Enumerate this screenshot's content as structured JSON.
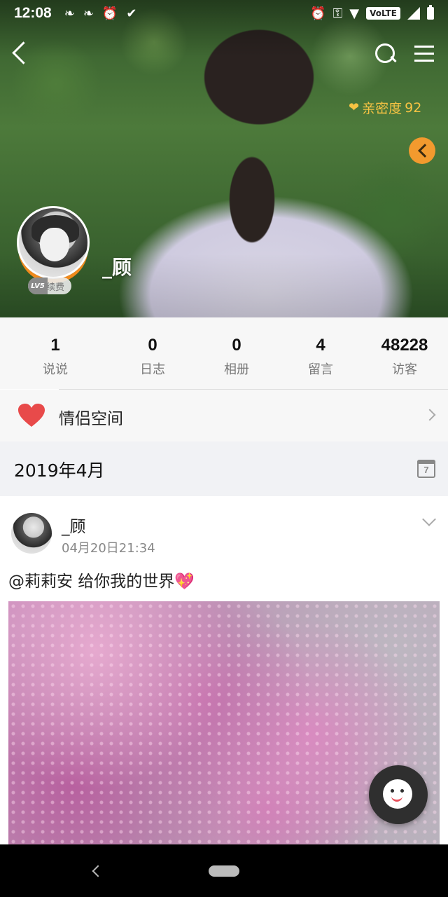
{
  "status_bar": {
    "time": "12:08",
    "volte": "VoLTE"
  },
  "profile": {
    "intimacy_label": "亲密度",
    "intimacy_value": "92",
    "username": "_顾",
    "vip_level": "LV5",
    "vip_action": "续费"
  },
  "stats": [
    {
      "value": "1",
      "label": "说说"
    },
    {
      "value": "0",
      "label": "日志"
    },
    {
      "value": "0",
      "label": "相册"
    },
    {
      "value": "4",
      "label": "留言"
    },
    {
      "value": "48228",
      "label": "访客"
    }
  ],
  "couple_space": {
    "label": "情侣空间"
  },
  "month_header": {
    "month": "2019年4月",
    "calendar_day": "7"
  },
  "post": {
    "author": "_顾",
    "timestamp": "04月20日21:34",
    "text": "@莉莉安 给你我的世界",
    "emoji": "💖"
  },
  "colors": {
    "intimacy": "#f6c343",
    "orange_button": "#f29a2e",
    "heart": "#e84a4a"
  }
}
